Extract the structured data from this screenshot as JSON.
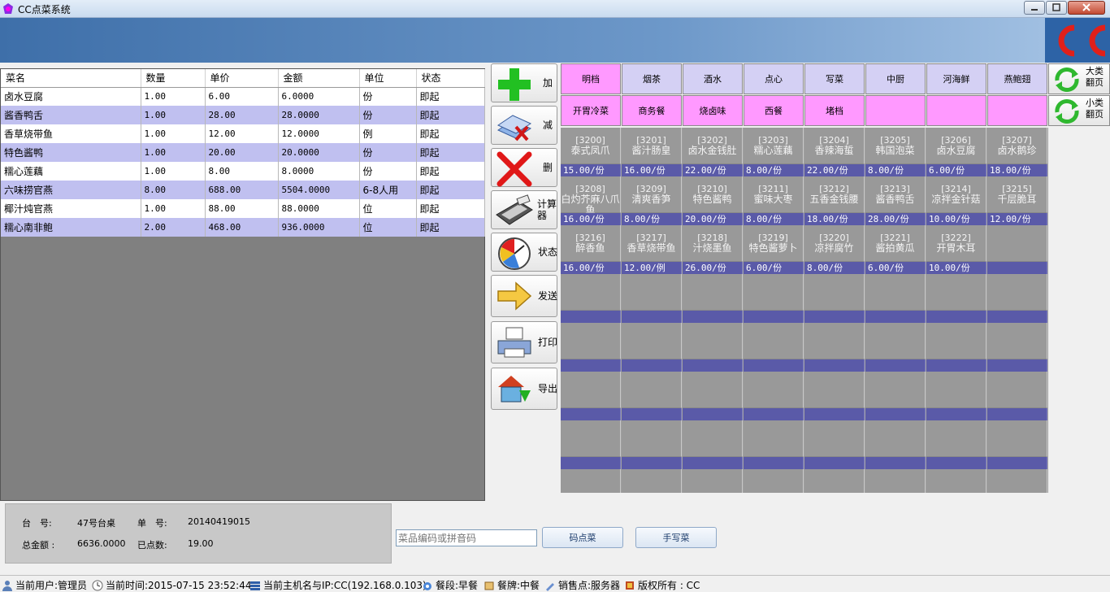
{
  "window": {
    "title": "CC点菜系统"
  },
  "order_table": {
    "headers": [
      "菜名",
      "数量",
      "单价",
      "金额",
      "单位",
      "状态"
    ],
    "rows": [
      [
        "卤水豆腐",
        "1.00",
        "6.00",
        "6.0000",
        "份",
        "即起"
      ],
      [
        "酱香鸭舌",
        "1.00",
        "28.00",
        "28.0000",
        "份",
        "即起"
      ],
      [
        "香草烧带鱼",
        "1.00",
        "12.00",
        "12.0000",
        "例",
        "即起"
      ],
      [
        "特色酱鸭",
        "1.00",
        "20.00",
        "20.0000",
        "份",
        "即起"
      ],
      [
        "糯心莲藕",
        "1.00",
        "8.00",
        "8.0000",
        "份",
        "即起"
      ],
      [
        "六味捞官燕",
        "8.00",
        "688.00",
        "5504.0000",
        "6-8人用",
        "即起"
      ],
      [
        "椰汁炖官燕",
        "1.00",
        "88.00",
        "88.0000",
        "位",
        "即起"
      ],
      [
        "糯心南非鲍",
        "2.00",
        "468.00",
        "936.0000",
        "位",
        "即起"
      ]
    ]
  },
  "actions": {
    "add": "加",
    "reduce": "减",
    "delete": "删",
    "calculator": "计算器",
    "status": "状态",
    "send": "发送",
    "print": "打印",
    "export": "导出"
  },
  "big_categories": [
    "明档",
    "烟茶",
    "酒水",
    "点心",
    "写菜",
    "中厨",
    "河海鲜",
    "燕鲍翅"
  ],
  "small_categories": [
    "开胃冷菜",
    "商务餐",
    "烧卤味",
    "西餐",
    "堵档",
    "",
    "",
    ""
  ],
  "paging": {
    "big": "大类翻页",
    "small": "小类翻页"
  },
  "dishes": [
    {
      "code": "[3200]",
      "name": "泰式凤爪",
      "price": "15.00/份"
    },
    {
      "code": "[3201]",
      "name": "酱汁肠皇",
      "price": "16.00/份"
    },
    {
      "code": "[3202]",
      "name": "卤水金钱肚",
      "price": "22.00/份"
    },
    {
      "code": "[3203]",
      "name": "糯心莲藕",
      "price": "8.00/份"
    },
    {
      "code": "[3204]",
      "name": "香辣海蜇",
      "price": "22.00/份"
    },
    {
      "code": "[3205]",
      "name": "韩国泡菜",
      "price": "8.00/份"
    },
    {
      "code": "[3206]",
      "name": "卤水豆腐",
      "price": "6.00/份"
    },
    {
      "code": "[3207]",
      "name": "卤水鹅珍",
      "price": "18.00/份"
    },
    {
      "code": "[3208]",
      "name": "白灼芥麻八爪鱼",
      "price": "16.00/份"
    },
    {
      "code": "[3209]",
      "name": "清爽香笋",
      "price": "8.00/份"
    },
    {
      "code": "[3210]",
      "name": "特色酱鸭",
      "price": "20.00/份"
    },
    {
      "code": "[3211]",
      "name": "蜜味大枣",
      "price": "8.00/份"
    },
    {
      "code": "[3212]",
      "name": "五香金钱腰",
      "price": "18.00/份"
    },
    {
      "code": "[3213]",
      "name": "酱香鸭舌",
      "price": "28.00/份"
    },
    {
      "code": "[3214]",
      "name": "凉拌金针菇",
      "price": "10.00/份"
    },
    {
      "code": "[3215]",
      "name": "千层脆耳",
      "price": "12.00/份"
    },
    {
      "code": "[3216]",
      "name": "醉香鱼",
      "price": "16.00/份"
    },
    {
      "code": "[3217]",
      "name": "香草烧带鱼",
      "price": "12.00/例"
    },
    {
      "code": "[3218]",
      "name": "汁烧墨鱼",
      "price": "26.00/份"
    },
    {
      "code": "[3219]",
      "name": "特色酱萝卜",
      "price": "6.00/份"
    },
    {
      "code": "[3220]",
      "name": "凉拌腐竹",
      "price": "8.00/份"
    },
    {
      "code": "[3221]",
      "name": "酱拍黄瓜",
      "price": "6.00/份"
    },
    {
      "code": "[3222]",
      "name": "开胃木耳",
      "price": "10.00/份"
    }
  ],
  "info": {
    "table_label": "台　号:",
    "table_value": "47号台桌",
    "order_label": "单　号:",
    "order_value": "20140419015",
    "total_label": "总金额 :",
    "total_value": "6636.0000",
    "count_label": "已点数:",
    "count_value": "19.00"
  },
  "search": {
    "placeholder": "菜品编码或拼音码",
    "code_button": "码点菜",
    "handwrite_button": "手写菜"
  },
  "status_bar": {
    "user": "当前用户:管理员",
    "time": "当前时间:2015-07-15 23:52:44",
    "host": "当前主机名与IP:CC(192.168.0.103)",
    "meal": "餐段:早餐",
    "brand": "餐牌:中餐",
    "pos": "销售点:服务器",
    "copyright": "版权所有 : CC"
  }
}
